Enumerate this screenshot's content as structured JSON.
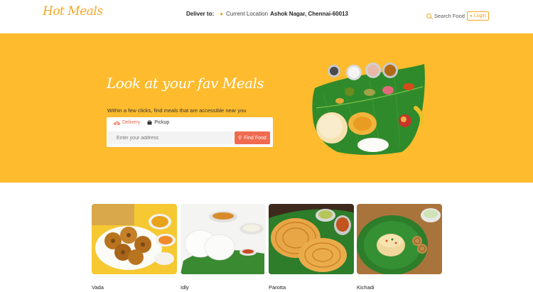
{
  "header": {
    "logo": "Hot Meals",
    "deliver_label": "Deliver to:",
    "current_location_label": "Current Location",
    "address": "Ashok Nagar, Chennai-60013",
    "search_label": "Search Food",
    "login_label": "Login"
  },
  "hero": {
    "title": "Look at your fav Meals",
    "subtitle": "Within a few clicks, find meals that are accessible near you",
    "tabs": [
      {
        "label": "Delivery",
        "icon": "scooter-icon",
        "active": true
      },
      {
        "label": "Pickup",
        "icon": "bag-icon",
        "active": false
      }
    ],
    "address_placeholder": "Enter your address",
    "find_button": "Find Food"
  },
  "foods": [
    {
      "name": "Vada"
    },
    {
      "name": "Idly"
    },
    {
      "name": "Parotta"
    },
    {
      "name": "Kichadi"
    }
  ],
  "colors": {
    "brand": "#f5a623",
    "hero_bg": "#fdbb2d",
    "button": "#f06a50",
    "active_tab": "#e8634a"
  }
}
